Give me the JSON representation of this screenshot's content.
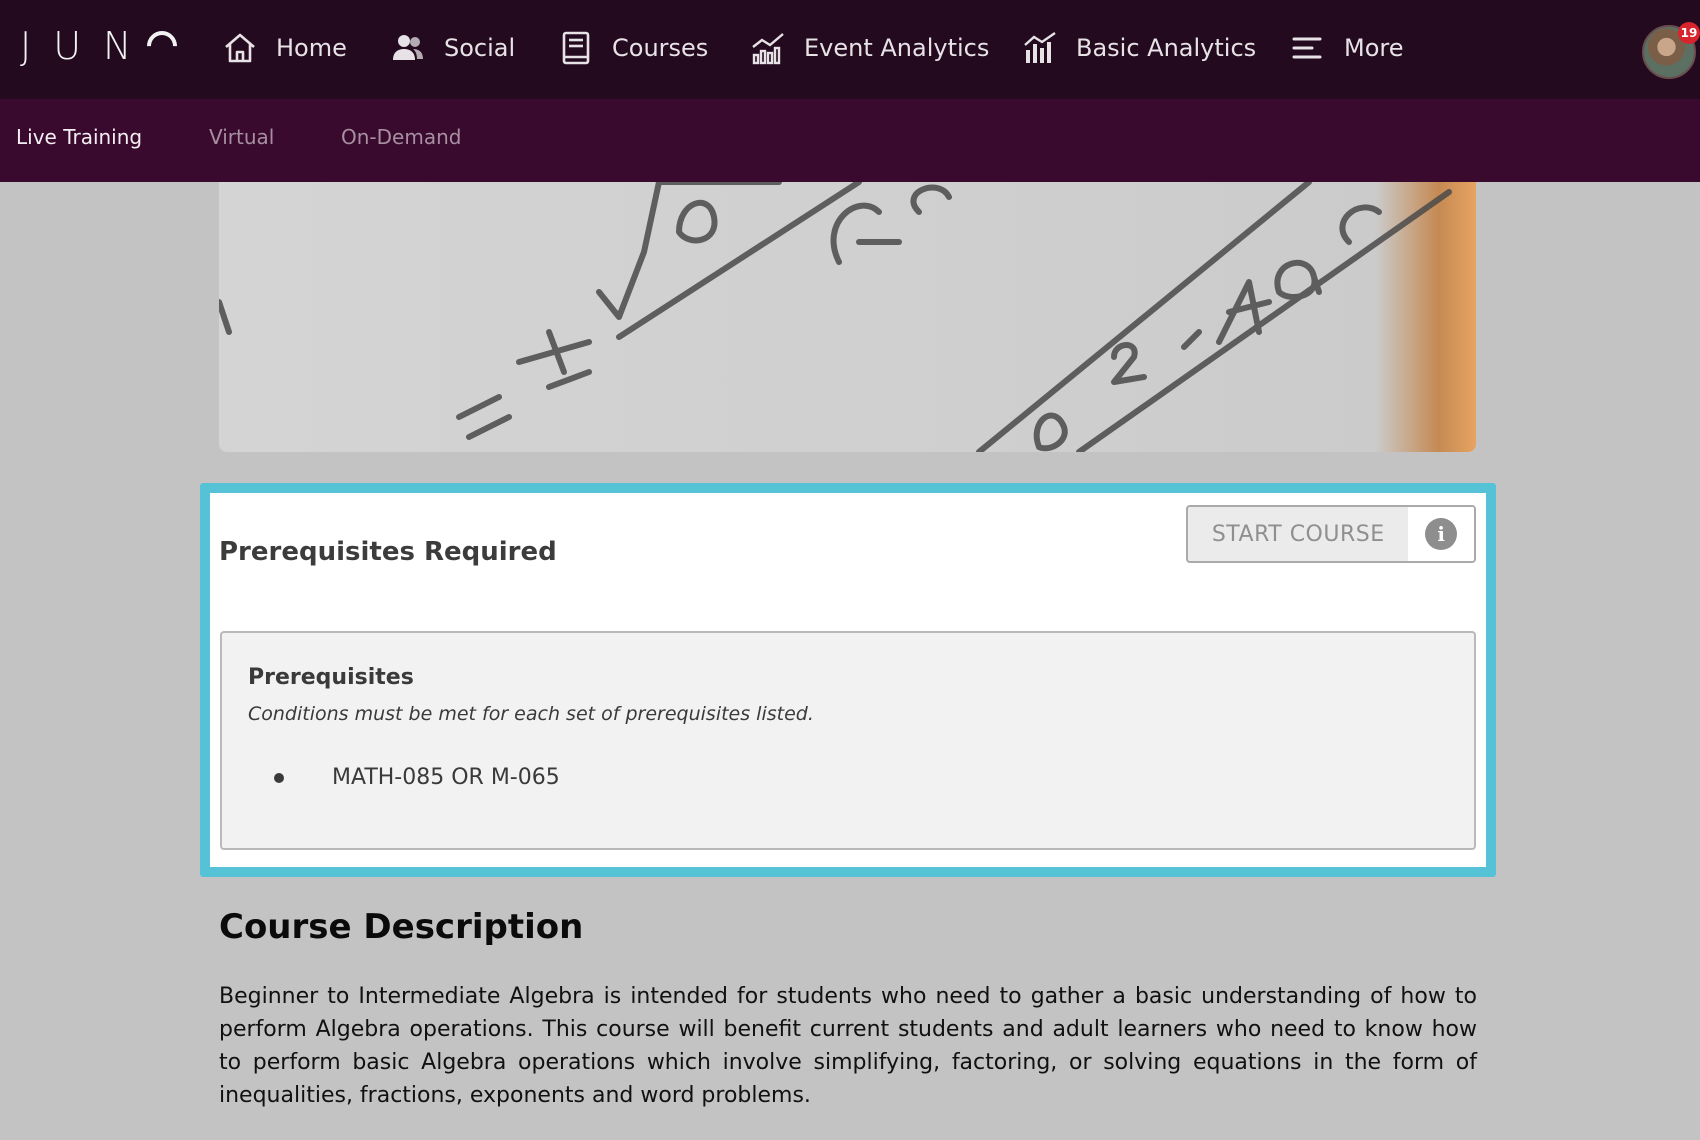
{
  "app": {
    "logo": "JUN"
  },
  "nav": {
    "items": [
      {
        "label": "Home",
        "icon": "home-icon"
      },
      {
        "label": "Social",
        "icon": "users-icon"
      },
      {
        "label": "Courses",
        "icon": "book-icon"
      },
      {
        "label": "Event Analytics",
        "icon": "event-analytics-icon"
      },
      {
        "label": "Basic Analytics",
        "icon": "bar-chart-icon"
      },
      {
        "label": "More",
        "icon": "menu-icon"
      }
    ],
    "notification_count": "19"
  },
  "subnav": {
    "items": [
      {
        "label": "Live Training",
        "active": true
      },
      {
        "label": "Virtual",
        "active": false
      },
      {
        "label": "On-Demand",
        "active": false
      }
    ]
  },
  "prereq_card": {
    "title": "Prerequisites Required",
    "start_button": "START COURSE",
    "info_symbol": "i",
    "box": {
      "heading": "Prerequisites",
      "note": "Conditions must be met for each set of prerequisites listed.",
      "items": [
        "MATH-085 OR M-065"
      ]
    }
  },
  "description": {
    "title": "Course Description",
    "text": "Beginner to Intermediate Algebra is intended for students who need to gather a basic understanding of how to perform Algebra operations. This course will benefit current students and adult learners who need to know how to perform basic Algebra operations which involve simplifying, factoring, or solving equations in the form of inequalities, fractions, exponents and word problems."
  },
  "colors": {
    "topnav_bg": "#230a1f",
    "subnav_bg": "#3a0a2e",
    "card_border": "#55c2d6",
    "page_bg": "#c3c3c3"
  }
}
